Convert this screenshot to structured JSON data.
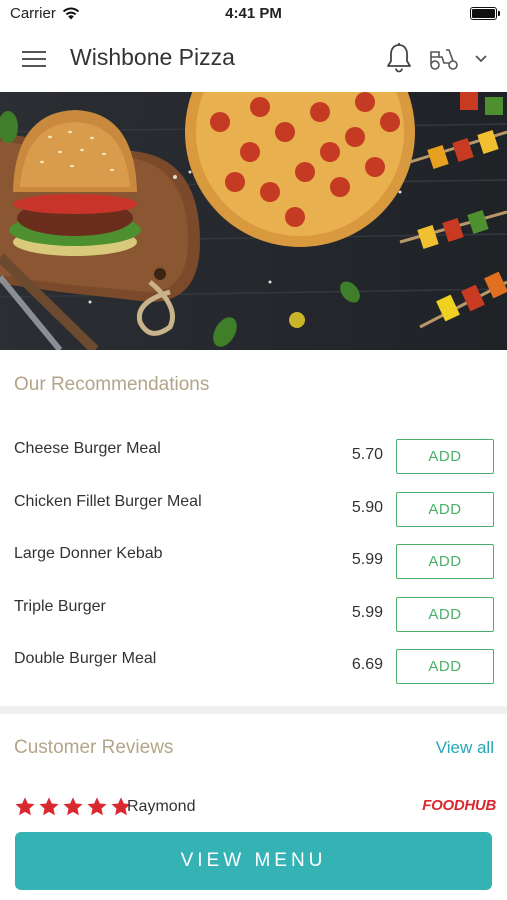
{
  "status_bar": {
    "carrier": "Carrier",
    "time": "4:41 PM"
  },
  "header": {
    "title": "Wishbone Pizza",
    "icons": [
      "menu-icon",
      "bell-icon",
      "scooter-icon",
      "chevron-down-icon"
    ]
  },
  "recommendations": {
    "title": "Our Recommendations",
    "add_label": "ADD",
    "items": [
      {
        "name": "Cheese Burger Meal",
        "price": "5.70"
      },
      {
        "name": "Chicken Fillet Burger Meal",
        "price": "5.90"
      },
      {
        "name": "Large Donner Kebab",
        "price": "5.99"
      },
      {
        "name": "Triple Burger",
        "price": "5.99"
      },
      {
        "name": "Double Burger Meal",
        "price": "6.69"
      }
    ]
  },
  "reviews": {
    "title": "Customer Reviews",
    "view_all": "View all",
    "items": [
      {
        "rating": 5,
        "reviewer": "Raymond",
        "source": "FOODHUB"
      }
    ]
  },
  "footer": {
    "view_menu": "VIEW MENU"
  },
  "colors": {
    "accent": "#35b2b4",
    "add_green": "#4caf6a",
    "section_title": "#b3a589",
    "link": "#2aa6b7",
    "star": "#d9282f"
  }
}
